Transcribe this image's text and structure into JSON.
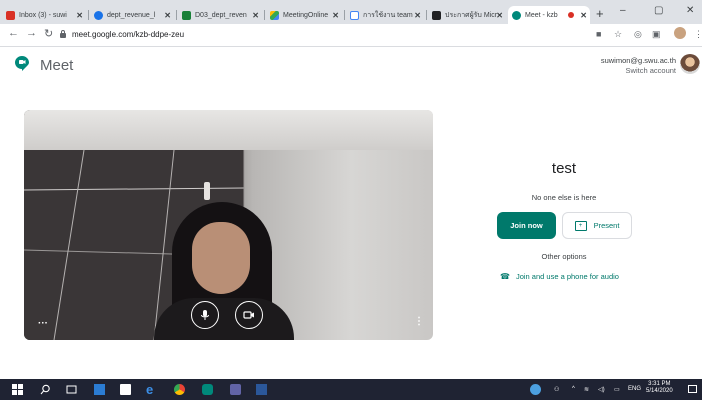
{
  "browser": {
    "tabs": [
      {
        "title": "Inbox (3) - suwi",
        "favicon_color": "#d93025"
      },
      {
        "title": "dept_revenue_l",
        "favicon_color": "#1a73e8"
      },
      {
        "title": "D03_dept_reven",
        "favicon_color": "#188038"
      },
      {
        "title": "MeetingOnline",
        "favicon_color": "#fbbc04"
      },
      {
        "title": "การใช้งาน team",
        "favicon_color": "#4285f4"
      },
      {
        "title": "ประกาศผู้รับ Micr",
        "favicon_color": "#202124"
      },
      {
        "title": "Meet - kzb",
        "favicon_color": "#00897b",
        "active": true
      }
    ],
    "close_glyph": "✕",
    "new_tab_glyph": "+",
    "window_controls": [
      "–",
      "▢",
      "✕"
    ],
    "nav": {
      "back": "←",
      "forward": "→",
      "reload": "↻"
    },
    "url": "meet.google.com/kzb-ddpe-zeu",
    "toolbar_icons": [
      "camera-icon",
      "star-icon",
      "record-icon",
      "extension-icon",
      "profile-icon",
      "more-icon"
    ]
  },
  "meet": {
    "brand": "Meet",
    "account": {
      "email": "suwimon@g.swu.ac.th",
      "switch_label": "Switch account"
    },
    "meeting_title": "test",
    "status": "No one else is here",
    "join_label": "Join now",
    "present_label": "Present",
    "other_options": "Other options",
    "phone_label": "Join and use a phone for audio",
    "accent": "#00796b"
  },
  "video": {
    "mic_icon": "microphone-icon",
    "camera_icon": "camera-icon",
    "more_icon": "more-vertical-icon",
    "effects_icon": "more-horizontal-icon"
  },
  "taskbar": {
    "time": "3:31 PM",
    "date": "5/14/2020",
    "language": "ENG"
  }
}
